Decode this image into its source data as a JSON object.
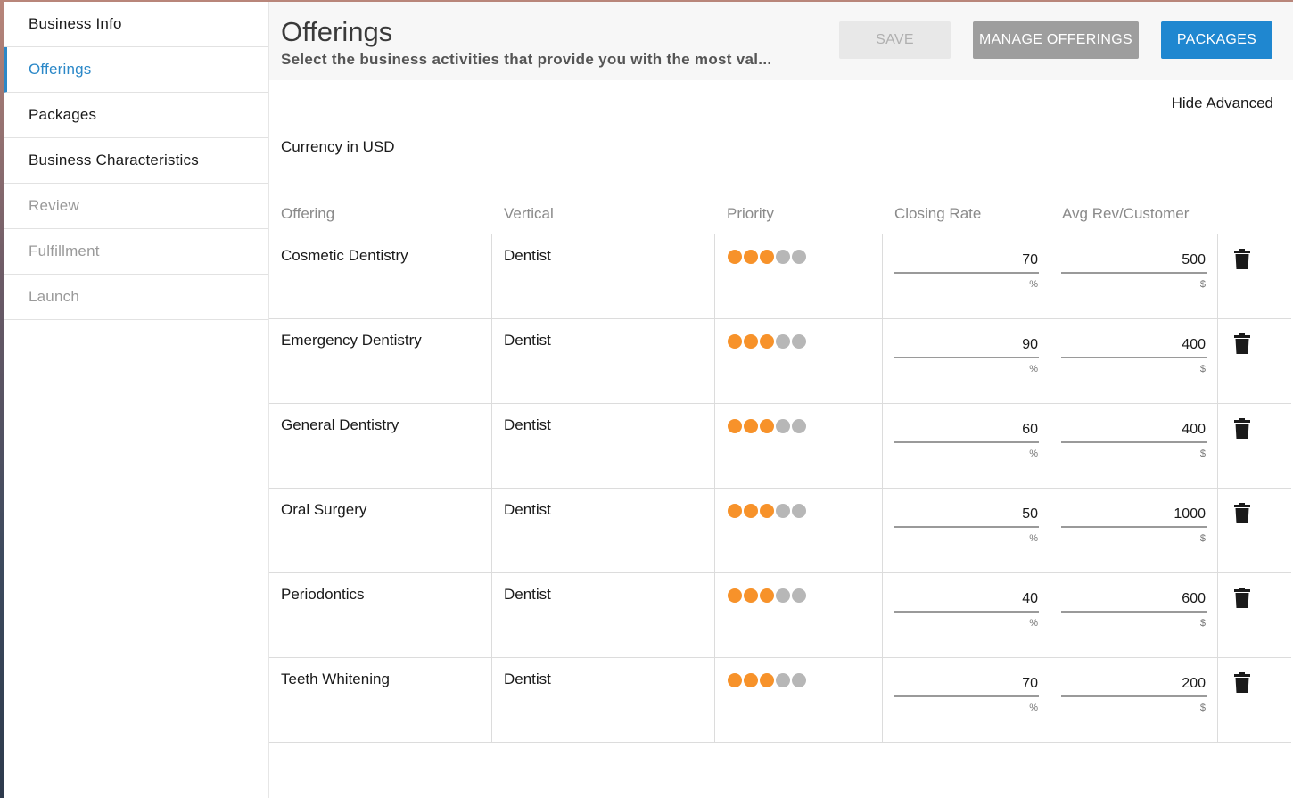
{
  "sidebar": {
    "items": [
      {
        "label": "Business Info",
        "state": "normal"
      },
      {
        "label": "Offerings",
        "state": "active"
      },
      {
        "label": "Packages",
        "state": "normal"
      },
      {
        "label": "Business Characteristics",
        "state": "normal"
      },
      {
        "label": "Review",
        "state": "disabled"
      },
      {
        "label": "Fulfillment",
        "state": "disabled"
      },
      {
        "label": "Launch",
        "state": "disabled"
      }
    ]
  },
  "header": {
    "title": "Offerings",
    "subtitle": "Select the business activities that provide you with the most val...",
    "save_label": "SAVE",
    "manage_label": "MANAGE OFFERINGS",
    "packages_label": "PACKAGES"
  },
  "hide_advanced": "Hide Advanced",
  "currency": "Currency in USD",
  "table": {
    "columns": [
      "Offering",
      "Vertical",
      "Priority",
      "Closing Rate",
      "Avg Rev/Customer"
    ],
    "rows": [
      {
        "offering": "Cosmetic Dentistry",
        "vertical": "Dentist",
        "priority": 3,
        "closing_rate": "70",
        "closing_unit": "%",
        "avg_rev": "500",
        "avg_unit": "$"
      },
      {
        "offering": "Emergency Dentistry",
        "vertical": "Dentist",
        "priority": 3,
        "closing_rate": "90",
        "closing_unit": "%",
        "avg_rev": "400",
        "avg_unit": "$"
      },
      {
        "offering": "General Dentistry",
        "vertical": "Dentist",
        "priority": 3,
        "closing_rate": "60",
        "closing_unit": "%",
        "avg_rev": "400",
        "avg_unit": "$"
      },
      {
        "offering": "Oral Surgery",
        "vertical": "Dentist",
        "priority": 3,
        "closing_rate": "50",
        "closing_unit": "%",
        "avg_rev": "1000",
        "avg_unit": "$"
      },
      {
        "offering": "Periodontics",
        "vertical": "Dentist",
        "priority": 3,
        "closing_rate": "40",
        "closing_unit": "%",
        "avg_rev": "600",
        "avg_unit": "$"
      },
      {
        "offering": "Teeth Whitening",
        "vertical": "Dentist",
        "priority": 3,
        "closing_rate": "70",
        "closing_unit": "%",
        "avg_rev": "200",
        "avg_unit": "$"
      }
    ],
    "priority_max": 5
  },
  "colors": {
    "accent": "#2b88c8",
    "primary_button": "#1f87d0",
    "priority_on": "#f7922a",
    "priority_off": "#b7b7b7"
  }
}
